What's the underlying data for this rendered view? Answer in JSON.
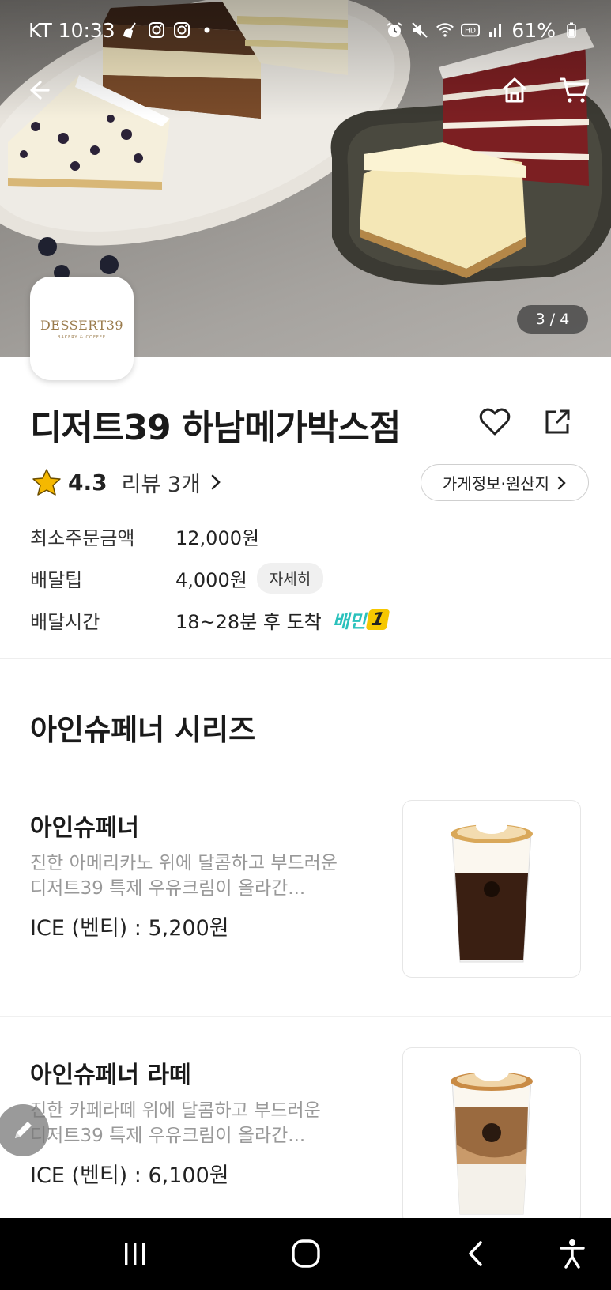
{
  "status_bar": {
    "carrier_time": "KT 10:33",
    "battery": "61%",
    "colors": {
      "text": "#ffffff"
    }
  },
  "hero": {
    "page_indicator": "3 / 4",
    "logo_text": "DESSERT39",
    "logo_subtext": "BAKERY & COFFEE"
  },
  "store": {
    "name": "디저트39 하남메가박스점",
    "rating": "4.3",
    "reviews_label": "리뷰 3개",
    "info_button": "가게정보·원산지",
    "min_order_label": "최소주문금액",
    "min_order_value": "12,000원",
    "delivery_tip_label": "배달팁",
    "delivery_tip_value": "4,000원",
    "detail_label": "자세히",
    "delivery_time_label": "배달시간",
    "delivery_time_value": "18~28분 후 도착",
    "badge_text": "배민",
    "badge_num": "1"
  },
  "section": {
    "title": "아인슈페너 시리즈"
  },
  "menu_items": [
    {
      "name": "아인슈페너",
      "desc_line1": "진한 아메리카노 위에 달콤하고 부드러운",
      "desc_line2": "디저트39 특제 우유크림이 올라간...",
      "price": "ICE (벤티) : 5,200원"
    },
    {
      "name": "아인슈페너 라떼",
      "desc_line1": "진한 카페라떼 위에 달콤하고 부드러운",
      "desc_line2": "디저트39 특제 우유크림이 올라간...",
      "price": "ICE (벤티) : 6,100원"
    }
  ],
  "colors": {
    "accent_teal": "#2ac1bc",
    "badge_yellow": "#f6c700",
    "star": "#f5b800",
    "logo_gold": "#9a7b4c"
  },
  "icons": [
    "back-arrow-icon",
    "home-icon",
    "cart-icon",
    "heart-icon",
    "share-icon",
    "star-icon",
    "chevron-right-icon",
    "edit-pencil-icon",
    "recents-icon",
    "home-circle-icon",
    "back-chevron-icon",
    "accessibility-icon"
  ]
}
